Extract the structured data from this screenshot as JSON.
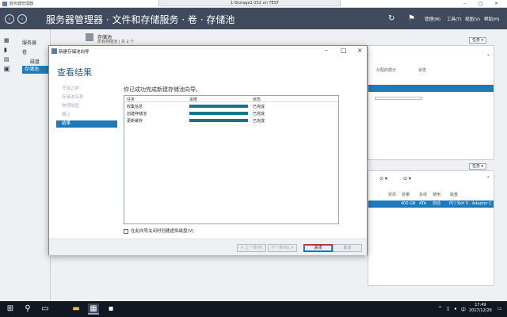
{
  "window": {
    "app_title": "服务器管理器",
    "remote_title": "1-Storage1-252 on TEST"
  },
  "header": {
    "breadcrumb": "服务器管理器 · 文件和存储服务 · 卷 · 存储池",
    "menu": [
      "管理(M)",
      "工具(T)",
      "视图(V)",
      "帮助(H)"
    ]
  },
  "leftnav": {
    "items": [
      "服务器",
      "卷",
      "磁盘",
      "存储池"
    ],
    "selected": "存储池"
  },
  "background": {
    "pool_title": "存储池",
    "pool_subtitle": "所有存储池 | 共 2 个",
    "task_label": "任务",
    "cols_top": [
      "分配的部分",
      "状态"
    ],
    "cols_bottom": [
      "状态",
      "容量",
      "总线",
      "使用",
      "底盘"
    ],
    "disk_row": [
      "400 GB",
      "ATA",
      "自动",
      "PCI Slot 0 : Adapter C"
    ]
  },
  "wizard": {
    "title": "新建存储池向导",
    "heading": "查看结果",
    "steps": [
      {
        "label": "开始之前",
        "active": false
      },
      {
        "label": "存储池名称",
        "active": false
      },
      {
        "label": "物理磁盘",
        "active": false
      },
      {
        "label": "确认",
        "active": false
      },
      {
        "label": "结果",
        "active": true
      }
    ],
    "message": "你已成功完成新建存储池向导。",
    "table": {
      "headers": [
        "任务",
        "进度",
        "状态"
      ],
      "rows": [
        {
          "task": "收集信息",
          "progress": 100,
          "status": "已完成"
        },
        {
          "task": "创建存储池",
          "progress": 100,
          "status": "已完成"
        },
        {
          "task": "更新缓存",
          "progress": 100,
          "status": "已完成"
        }
      ]
    },
    "checkbox_label": "在此向导关闭时创建虚拟磁盘(V)",
    "buttons": {
      "prev": "< 上一步(P)",
      "next": "下一步(N) >",
      "close": "关闭",
      "cancel": "取消"
    }
  },
  "taskbar": {
    "tray_lang": "中",
    "time": "17:49",
    "date": "2017/12/26"
  },
  "colors": {
    "accent": "#1f7ab8",
    "progress": "#16738e",
    "header_bg": "#3f4a5c",
    "highlight_border": "#c0282f"
  }
}
